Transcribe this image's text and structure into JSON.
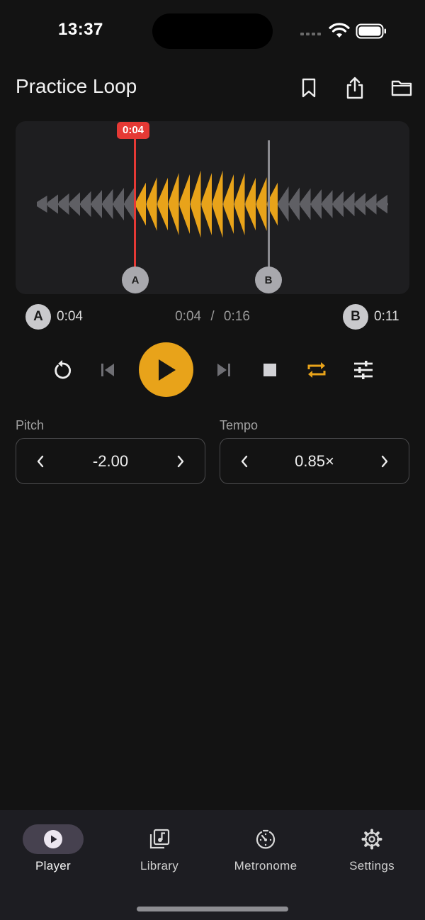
{
  "status_bar": {
    "time": "13:37"
  },
  "header": {
    "title": "Practice Loop"
  },
  "waveform": {
    "playhead_label": "0:04",
    "marker_a_label": "A",
    "marker_b_label": "B",
    "colors": {
      "active": "#e8a31a",
      "inactive": "#5f5f64",
      "playhead": "#e53935",
      "loop_end": "#8a8a8f"
    }
  },
  "loop": {
    "a_label": "A",
    "a_time": "0:04",
    "b_label": "B",
    "b_time": "0:11",
    "current": "0:04",
    "separator": "/",
    "total": "0:16"
  },
  "controls": {
    "pitch_label": "Pitch",
    "pitch_value": "-2.00",
    "tempo_label": "Tempo",
    "tempo_value": "0.85×"
  },
  "nav": {
    "items": [
      {
        "label": "Player",
        "icon": "play-circle-icon",
        "active": true
      },
      {
        "label": "Library",
        "icon": "library-music-icon",
        "active": false
      },
      {
        "label": "Metronome",
        "icon": "metronome-icon",
        "active": false
      },
      {
        "label": "Settings",
        "icon": "gear-icon",
        "active": false
      }
    ]
  },
  "colors": {
    "accent": "#e8a31a",
    "background": "#131313",
    "surface": "#1e1e20"
  }
}
